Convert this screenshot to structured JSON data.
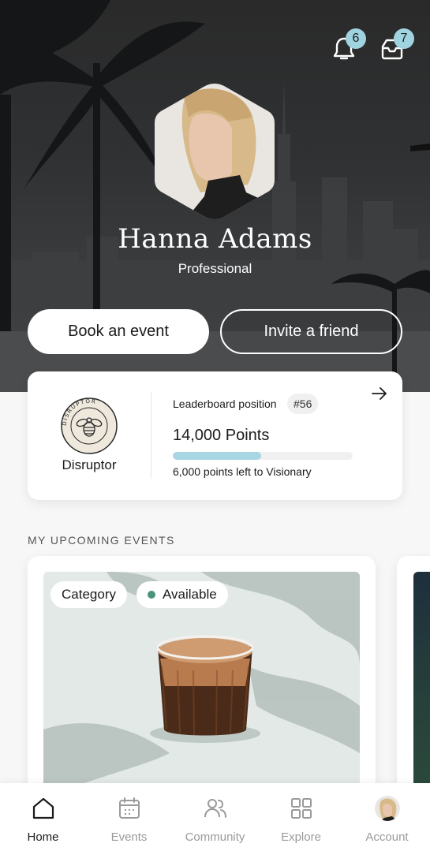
{
  "header": {
    "notifications_count": "6",
    "inbox_count": "7"
  },
  "profile": {
    "name": "Hanna Adams",
    "role": "Professional"
  },
  "actions": {
    "book_label": "Book an event",
    "invite_label": "Invite a friend"
  },
  "leaderboard": {
    "badge_name": "Disruptor",
    "badge_ring_text": "DISRUPTOR",
    "position_label": "Leaderboard position",
    "position_value": "#56",
    "points": "14,000 Points",
    "progress_fraction": 0.49,
    "points_left": "6,000 points left to Visionary"
  },
  "events": {
    "section_title": "MY UPCOMING EVENTS",
    "cards": [
      {
        "category": "Category",
        "status": "Available"
      }
    ]
  },
  "tabs": [
    {
      "label": "Home",
      "icon": "home-icon",
      "active": true
    },
    {
      "label": "Events",
      "icon": "calendar-icon",
      "active": false
    },
    {
      "label": "Community",
      "icon": "people-icon",
      "active": false
    },
    {
      "label": "Explore",
      "icon": "grid-icon",
      "active": false
    },
    {
      "label": "Account",
      "icon": "avatar",
      "active": false
    }
  ],
  "colors": {
    "accent": "#9fd3e0",
    "progress": "#a8d6e2",
    "available": "#4a9379"
  }
}
